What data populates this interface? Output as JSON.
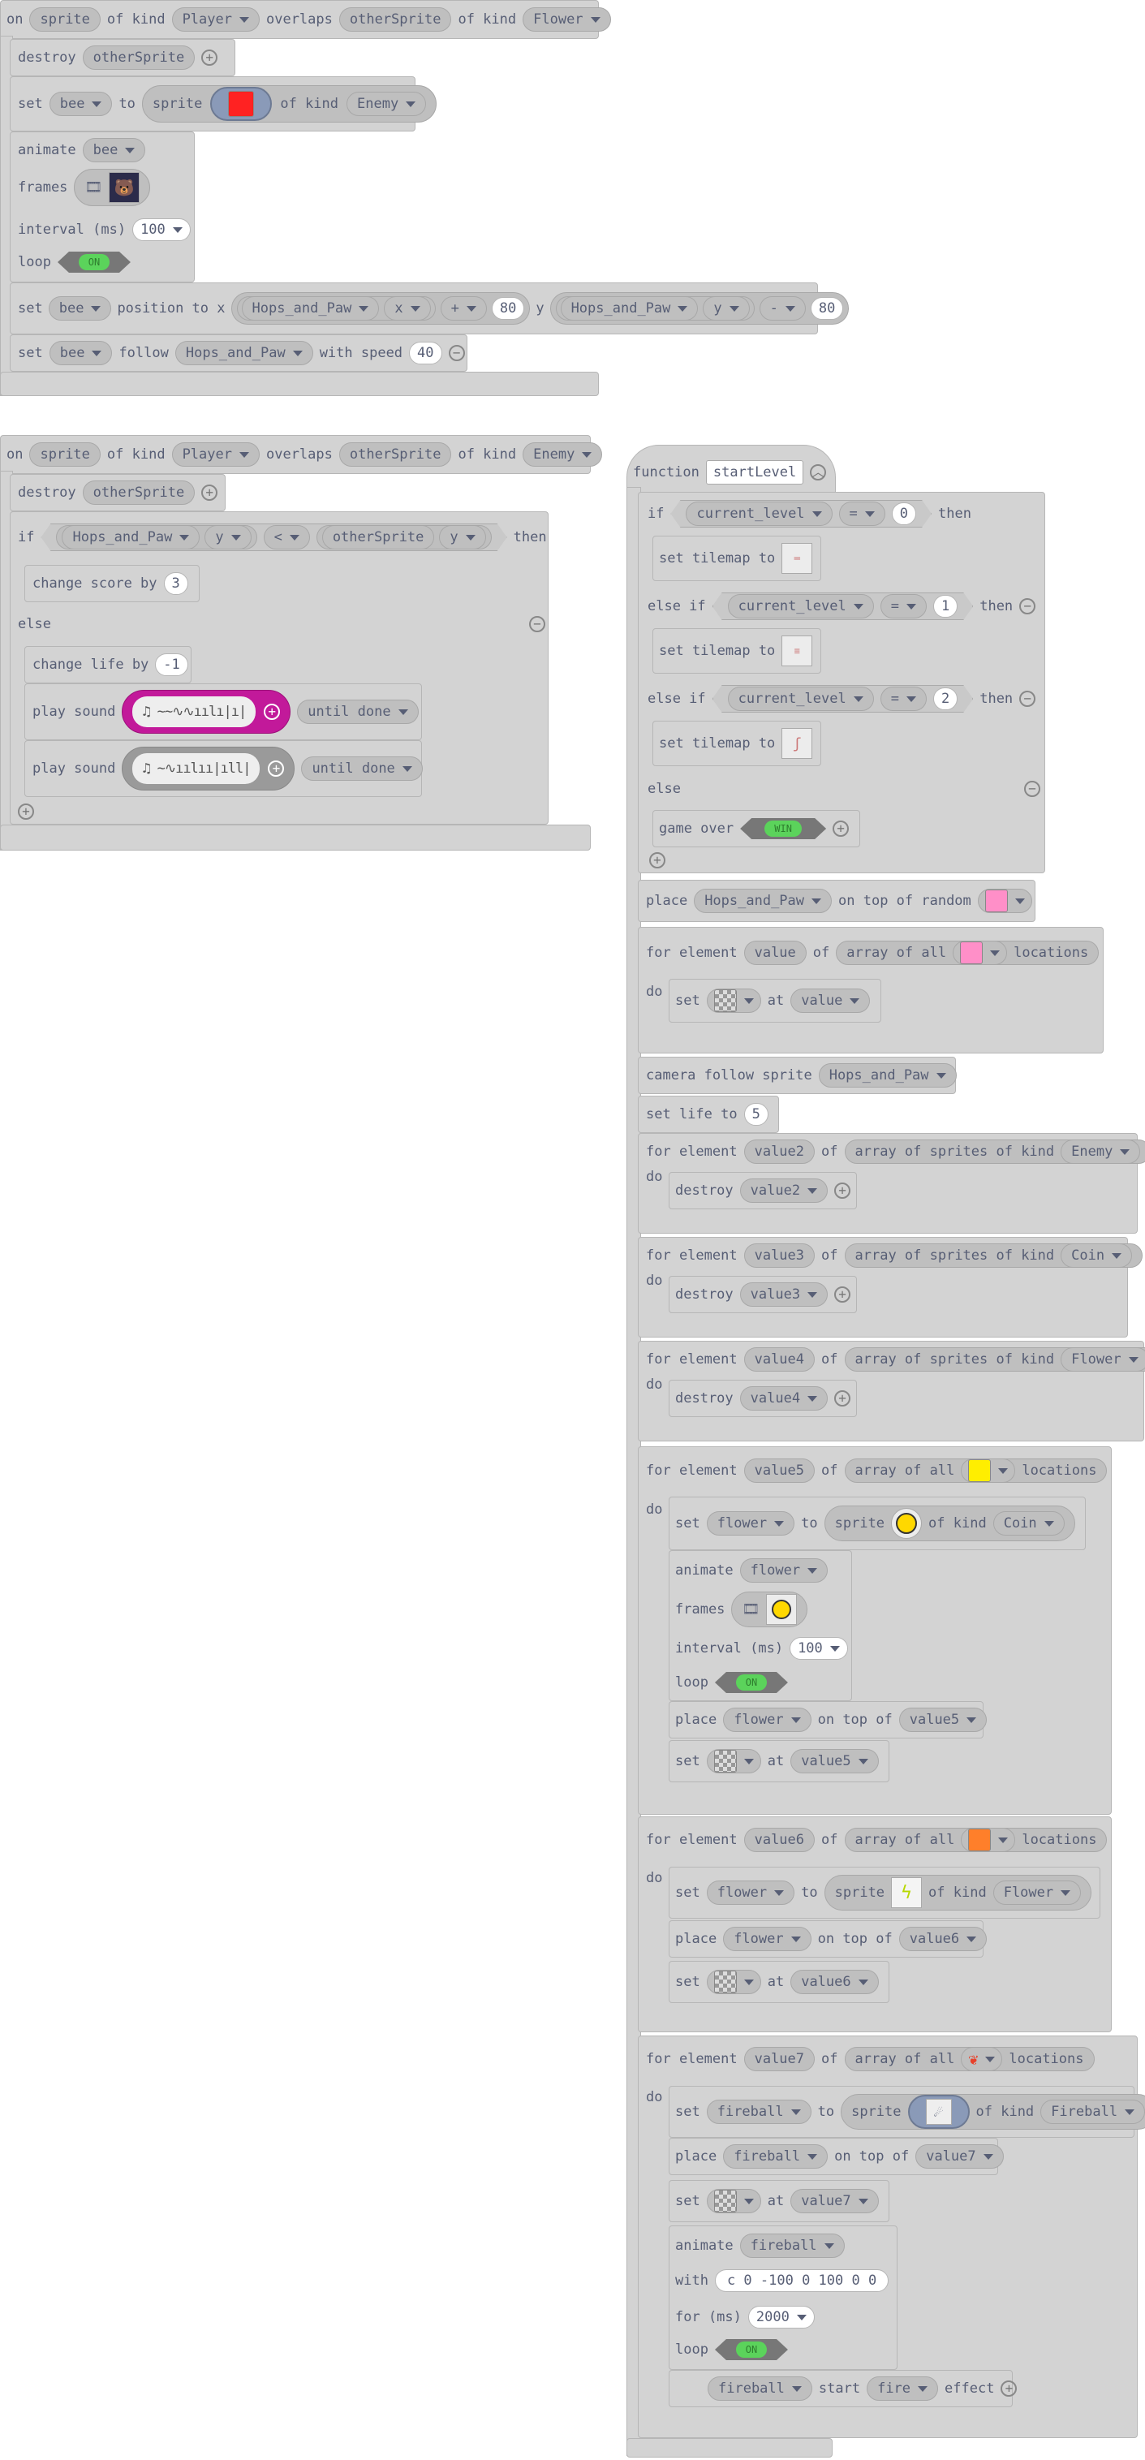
{
  "common": {
    "on": "on",
    "of_kind": "of kind",
    "overlaps": "overlaps",
    "sprite": "sprite",
    "otherSprite": "otherSprite",
    "destroy": "destroy",
    "set": "set",
    "to": "to",
    "animate": "animate",
    "frames": "frames",
    "interval_ms": "interval (ms)",
    "loop": "loop",
    "on_toggle": "ON",
    "position_to_x": "position to x",
    "y": "y",
    "follow": "follow",
    "with_speed": "with speed",
    "if": "if",
    "then": "then",
    "else": "else",
    "else_if": "else if",
    "change_score_by": "change score by",
    "change_life_by": "change life by",
    "play_sound": "play sound",
    "until_done": "until done",
    "function": "function",
    "set_tilemap_to": "set tilemap to",
    "game_over": "game over",
    "win_toggle": "WIN",
    "place": "place",
    "on_top_of_random": "on top of random",
    "for_element": "for element",
    "of": "of",
    "array_of_all": "array of all",
    "locations": "locations",
    "do": "do",
    "at": "at",
    "camera_follow_sprite": "camera follow sprite",
    "set_life_to": "set life to",
    "array_of_sprites_of_kind": "array of sprites of kind",
    "on_top_of": "on top of",
    "with": "with",
    "for_ms": "for (ms)",
    "start": "start",
    "effect": "effect"
  },
  "block1": {
    "kind1": "Player",
    "kind2": "Flower",
    "set_var": "bee",
    "set_kind": "Enemy",
    "anim_var": "bee",
    "interval": "100",
    "pos_var": "bee",
    "x_sprite": "Hops_and_Paw",
    "x_prop": "x",
    "x_op": "+",
    "x_val": "80",
    "y_sprite": "Hops_and_Paw",
    "y_prop": "y",
    "y_op": "-",
    "y_val": "80",
    "follow_var": "bee",
    "follow_target": "Hops_and_Paw",
    "speed": "40"
  },
  "block2": {
    "kind1": "Player",
    "kind2": "Enemy",
    "cmp_sprite": "Hops_and_Paw",
    "cmp_prop": "y",
    "cmp_op": "<",
    "cmp_other": "otherSprite",
    "cmp_prop2": "y",
    "score": "3",
    "life": "-1"
  },
  "block3": {
    "name": "startLevel",
    "cond_var": "current_level",
    "cond_op": "=",
    "v0": "0",
    "v1": "1",
    "v2": "2",
    "place_sprite": "Hops_and_Paw",
    "value": "value",
    "value2": "value2",
    "value3": "value3",
    "value4": "value4",
    "value5": "value5",
    "value6": "value6",
    "value7": "value7",
    "camera_target": "Hops_and_Paw",
    "life": "5",
    "kind_enemy": "Enemy",
    "kind_coin": "Coin",
    "kind_flower": "Flower",
    "kind_fireball": "Fireball",
    "flower": "flower",
    "fireball": "fireball",
    "anim_interval": "100",
    "path": "c 0 -100 0 100 0 0",
    "for_ms": "2000",
    "effect": "fire"
  },
  "colors": {
    "block_bg": "#d3d3d3",
    "red": "#ff2222",
    "pink": "#ff8fc8",
    "yellow": "#ffee00",
    "orange": "#ff7f2a",
    "sound_active": "#c2199a",
    "toggle_green": "#5bd35b"
  }
}
